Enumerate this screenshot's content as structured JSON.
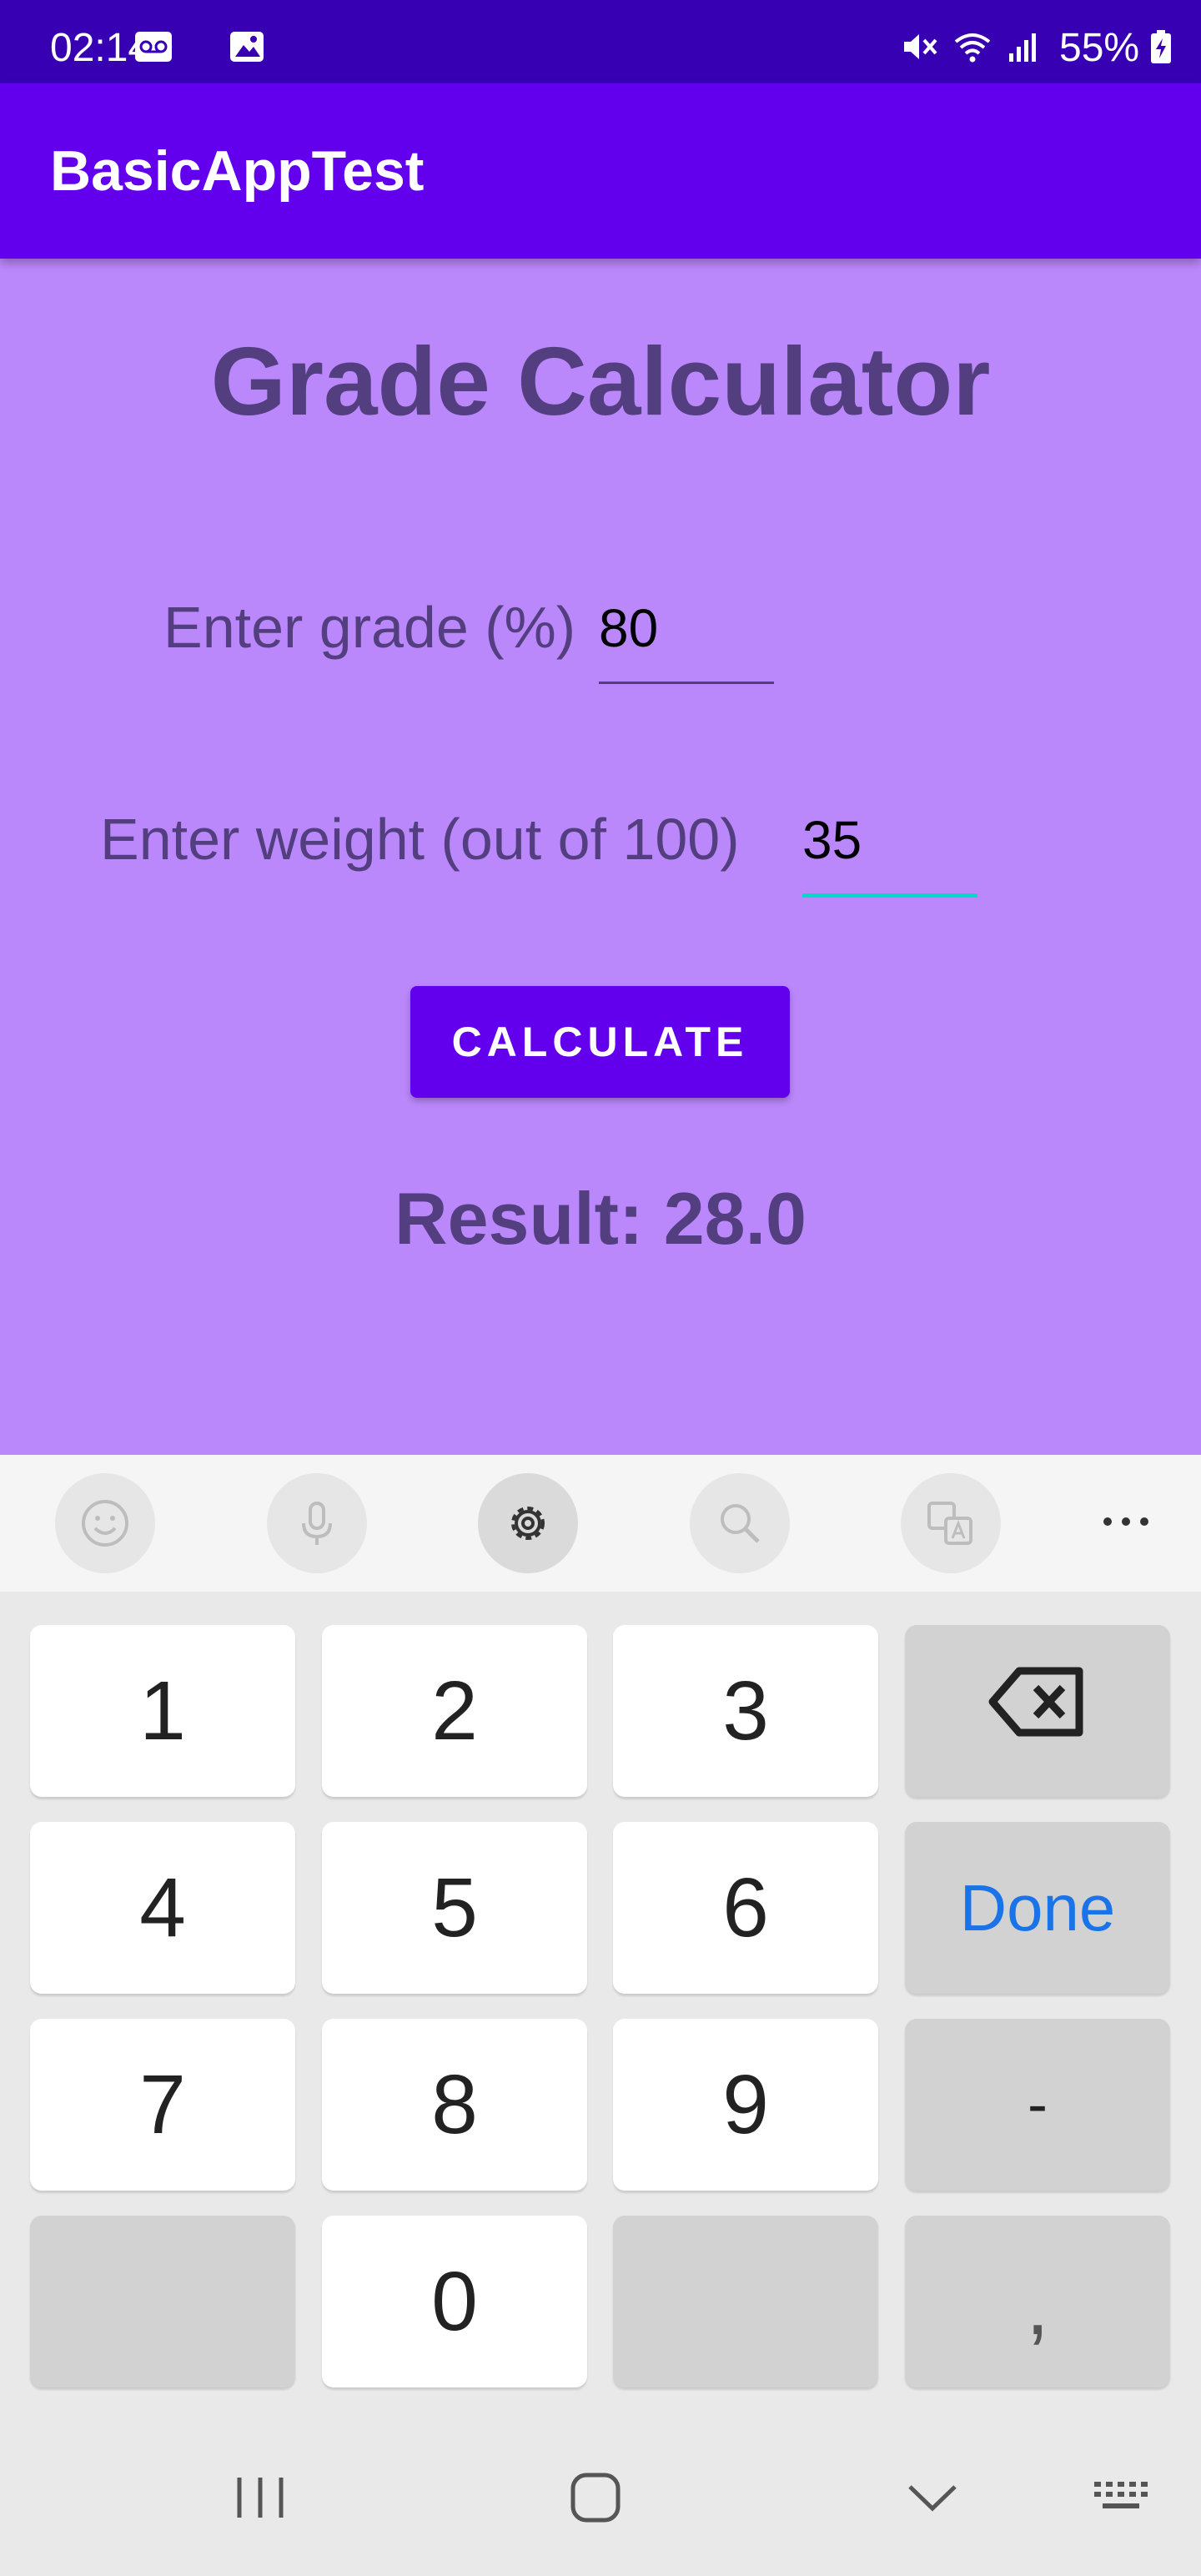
{
  "status_bar": {
    "time": "02:14",
    "battery": "55%",
    "icons": [
      "voicemail-icon",
      "image-icon",
      "mute-icon",
      "wifi-icon",
      "signal-icon",
      "battery-charging-icon"
    ]
  },
  "app_bar": {
    "title": "BasicAppTest"
  },
  "main": {
    "heading": "Grade Calculator",
    "grade_label": "Enter grade (%)",
    "grade_value": "80",
    "weight_label": "Enter weight (out of 100)",
    "weight_value": "35",
    "calculate_label": "CALCULATE",
    "result_text": "Result: 28.0"
  },
  "keyboard": {
    "toolbar": [
      "emoji-icon",
      "microphone-icon",
      "settings-icon",
      "search-icon",
      "translate-icon",
      "more-icon"
    ],
    "keys": {
      "k1": "1",
      "k2": "2",
      "k3": "3",
      "k4": "4",
      "k5": "5",
      "k6": "6",
      "k7": "7",
      "k8": "8",
      "k9": "9",
      "k0": "0",
      "done": "Done",
      "minus": "-",
      "comma": ","
    }
  },
  "nav_bar": {
    "icons": [
      "recents-icon",
      "home-icon",
      "back-icon",
      "keyboard-switch-icon"
    ]
  },
  "colors": {
    "status_bar": "#3700b3",
    "app_bar": "#6200ee",
    "background": "#bb88fc",
    "text": "#533f7f",
    "button": "#6200ee",
    "focus_underline": "#03dac5",
    "done_key": "#1a73e8"
  }
}
